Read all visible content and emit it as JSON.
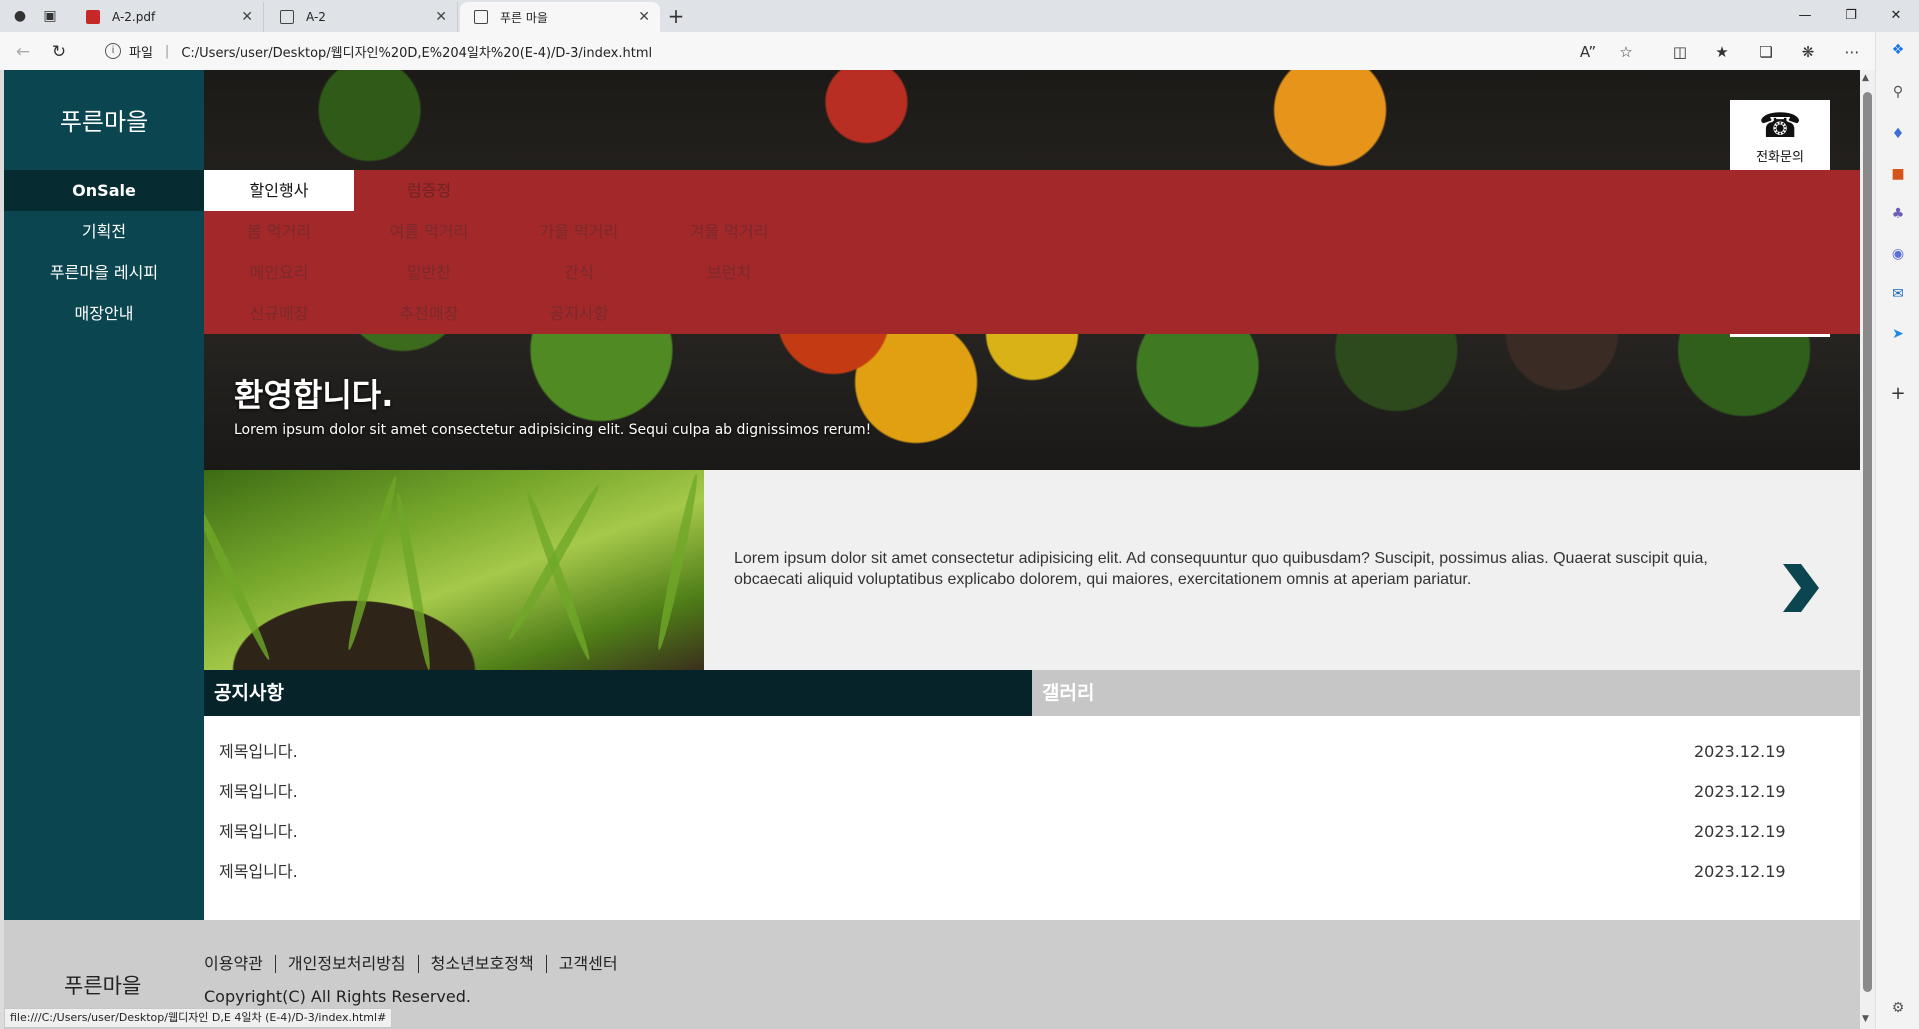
{
  "browser": {
    "tabs": [
      {
        "title": "A-2.pdf",
        "icon": "pdf-icon"
      },
      {
        "title": "A-2",
        "icon": "document-icon"
      },
      {
        "title": "푸른 마을",
        "icon": "document-icon",
        "active": true
      }
    ],
    "address": {
      "scheme_label": "파일",
      "url": "C:/Users/user/Desktop/웹디자인%20D,E%204일차%20(E-4)/D-3/index.html"
    },
    "status_url": "file:///C:/Users/user/Desktop/웹디자인 D,E 4일차 (E-4)/D-3/index.html#"
  },
  "site": {
    "logo": "푸른마을",
    "sidebar_nav": [
      {
        "label": "OnSale",
        "active": true
      },
      {
        "label": "기획전"
      },
      {
        "label": "푸른마을 레시피"
      },
      {
        "label": "매장안내"
      }
    ],
    "phone": {
      "label": "전화문의",
      "icon": "telephone-icon"
    },
    "menu": {
      "rows": [
        [
          "할인행사",
          "럼증정",
          "",
          ""
        ],
        [
          "봄 먹거리",
          "여름 먹거리",
          "가을 먹거리",
          "겨울 먹거리"
        ],
        [
          "메인요리",
          "밑반찬",
          "간식",
          "브런치"
        ],
        [
          "신규매장",
          "추천매장",
          "공지사항",
          ""
        ]
      ]
    },
    "hero": {
      "title": "환영합니다.",
      "subtitle": "Lorem ipsum dolor sit amet consectetur adipisicing elit. Sequi culpa ab dignissimos rerum!"
    },
    "feature": {
      "text": "Lorem ipsum dolor sit amet consectetur adipisicing elit. Ad consequuntur quo quibusdam? Suscipit, possimus alias. Quaerat suscipit quia, obcaecati aliquid voluptatibus explicabo dolorem, qui maiores, exercitationem omnis at aperiam pariatur."
    },
    "board": {
      "tabs": [
        "공지사항",
        "갤러리"
      ],
      "notices": [
        {
          "title": "제목입니다.",
          "date": "2023.12.19"
        },
        {
          "title": "제목입니다.",
          "date": "2023.12.19"
        },
        {
          "title": "제목입니다.",
          "date": "2023.12.19"
        },
        {
          "title": "제목입니다.",
          "date": "2023.12.19"
        }
      ]
    },
    "footer": {
      "logo": "푸른마을",
      "links": [
        "이용약관",
        "개인정보처리방침",
        "청소년보호정책",
        "고객센터"
      ],
      "copyright": "Copyright(C) All Rights Reserved."
    }
  },
  "colors": {
    "sidebar": "#0b4650",
    "sidebar_active": "#062b31",
    "menu_panel": "#a3282a",
    "board_tab_on": "#062329",
    "board_tab_off": "#c6c6c6",
    "footer": "#cccccc",
    "arrow": "#0b4650"
  }
}
